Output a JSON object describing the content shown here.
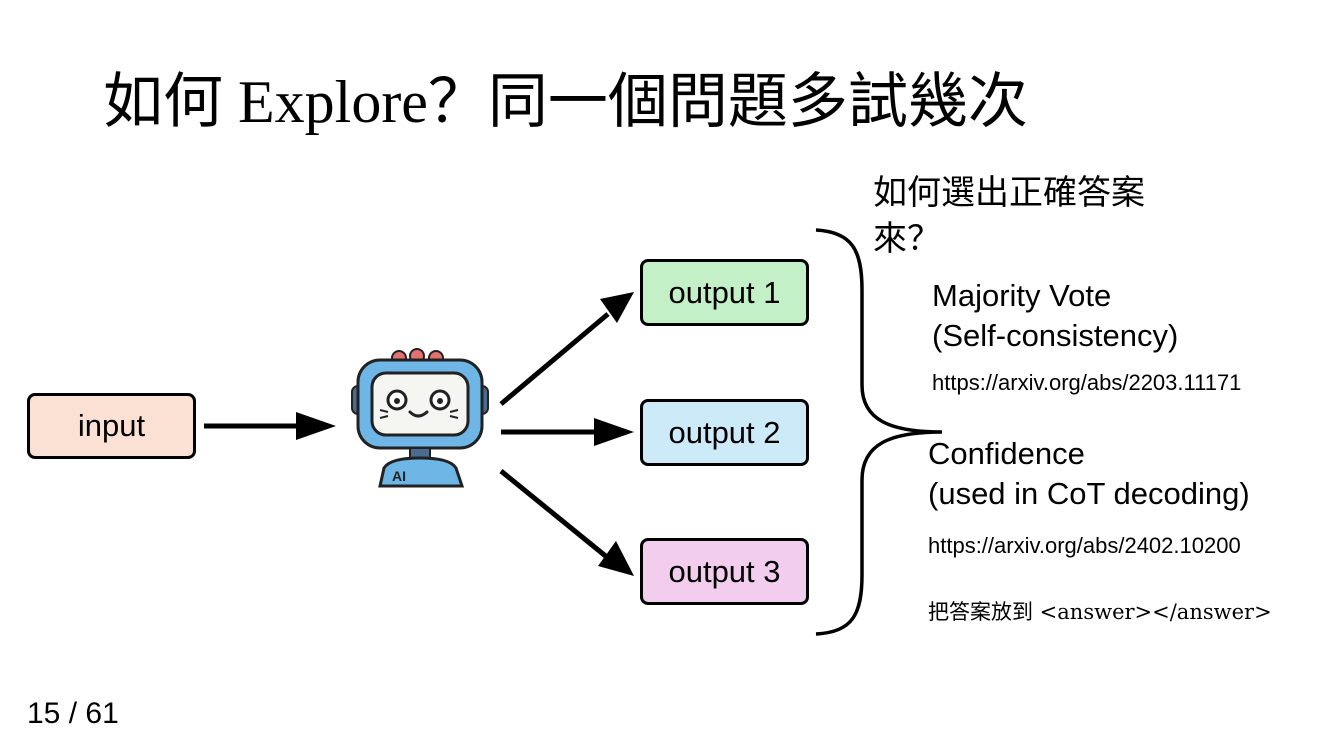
{
  "slide": {
    "title": "如何 Explore？同一個問題多試幾次",
    "page_current": "15",
    "page_separator": "/",
    "page_total": "61"
  },
  "diagram": {
    "input_label": "input",
    "robot_badge": "AI",
    "outputs": [
      {
        "label": "output 1",
        "color": "#c3f0c7"
      },
      {
        "label": "output 2",
        "color": "#cdeaf8"
      },
      {
        "label": "output 3",
        "color": "#f2cdee"
      }
    ],
    "input_color": "#fbe1d4",
    "robot_icon": "robot-icon"
  },
  "selection": {
    "question": "如何選出正確答案來？",
    "methods": [
      {
        "name_line1": "Majority Vote",
        "name_line2": "(Self-consistency)",
        "link": "https://arxiv.org/abs/2203.11171"
      },
      {
        "name_line1": "Confidence",
        "name_line2": "(used in CoT decoding)",
        "link": "https://arxiv.org/abs/2402.10200"
      }
    ],
    "note": "把答案放到 <answer></answer>"
  }
}
